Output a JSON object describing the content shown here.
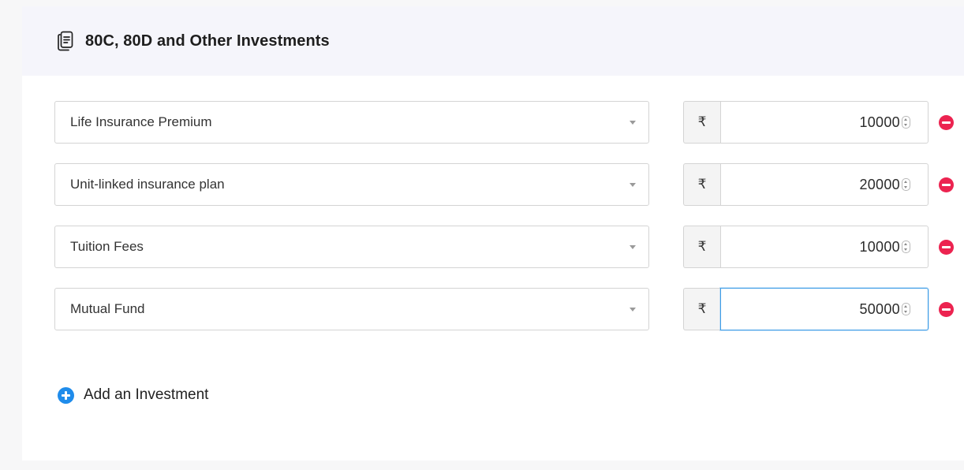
{
  "section": {
    "title": "80C, 80D and Other Investments",
    "icon": "document-icon"
  },
  "investments": [
    {
      "type_label": "Life Insurance Premium",
      "currency": "₹",
      "amount": "10000",
      "focused": false
    },
    {
      "type_label": "Unit-linked insurance plan",
      "currency": "₹",
      "amount": "20000",
      "focused": false
    },
    {
      "type_label": "Tuition Fees",
      "currency": "₹",
      "amount": "10000",
      "focused": false
    },
    {
      "type_label": "Mutual Fund",
      "currency": "₹",
      "amount": "50000",
      "focused": true
    }
  ],
  "add_button": {
    "label": "Add an Investment",
    "icon": "plus-circle-icon"
  },
  "colors": {
    "header_background": "#f5f5fb",
    "remove": "#ec2350",
    "add": "#1f8ceb",
    "focus_border": "#3d9ce6"
  }
}
